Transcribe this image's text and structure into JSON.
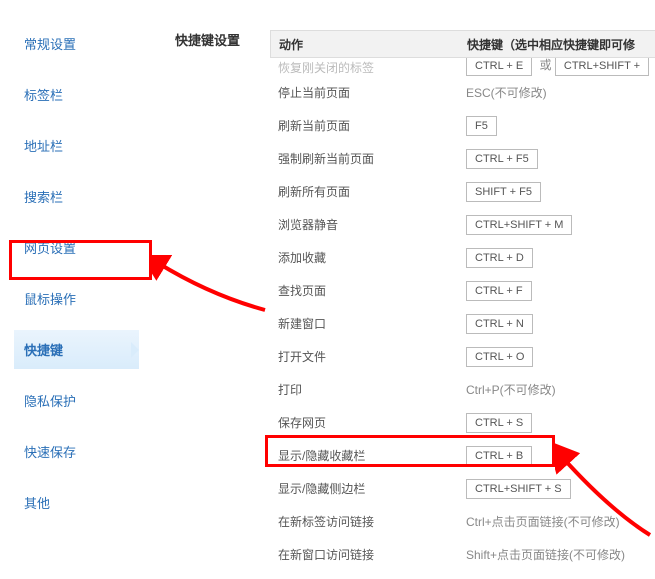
{
  "sidebar": {
    "items": [
      {
        "label": "常规设置"
      },
      {
        "label": "标签栏"
      },
      {
        "label": "地址栏"
      },
      {
        "label": "搜索栏"
      },
      {
        "label": "网页设置"
      },
      {
        "label": "鼠标操作"
      },
      {
        "label": "快捷键"
      },
      {
        "label": "隐私保护"
      },
      {
        "label": "快速保存"
      },
      {
        "label": "其他"
      }
    ],
    "active_index": 6
  },
  "main": {
    "section_title": "快捷键设置",
    "columns": {
      "action": "动作",
      "hotkey": "快捷键（选中相应快捷键即可修"
    },
    "rows": [
      {
        "action": "恢复刚关闭的标签",
        "keys": [
          "CTRL + E"
        ],
        "joiner": "或",
        "keys2": [
          "CTRL+SHIFT +"
        ],
        "type": "box"
      },
      {
        "action": "停止当前页面",
        "text": "ESC(不可修改)",
        "type": "text"
      },
      {
        "action": "刷新当前页面",
        "keys": [
          "F5"
        ],
        "type": "box"
      },
      {
        "action": "强制刷新当前页面",
        "keys": [
          "CTRL + F5"
        ],
        "type": "box"
      },
      {
        "action": "刷新所有页面",
        "keys": [
          "SHIFT + F5"
        ],
        "type": "box"
      },
      {
        "action": "浏览器静音",
        "keys": [
          "CTRL+SHIFT + M"
        ],
        "type": "box"
      },
      {
        "action": "添加收藏",
        "keys": [
          "CTRL + D"
        ],
        "type": "box"
      },
      {
        "action": "查找页面",
        "keys": [
          "CTRL + F"
        ],
        "type": "box"
      },
      {
        "action": "新建窗口",
        "keys": [
          "CTRL + N"
        ],
        "type": "box"
      },
      {
        "action": "打开文件",
        "keys": [
          "CTRL + O"
        ],
        "type": "box"
      },
      {
        "action": "打印",
        "text": "Ctrl+P(不可修改)",
        "type": "text"
      },
      {
        "action": "保存网页",
        "keys": [
          "CTRL + S"
        ],
        "type": "box"
      },
      {
        "action": "显示/隐藏收藏栏",
        "keys": [
          "CTRL + B"
        ],
        "type": "box"
      },
      {
        "action": "显示/隐藏侧边栏",
        "keys": [
          "CTRL+SHIFT + S"
        ],
        "type": "box"
      },
      {
        "action": "在新标签访问链接",
        "text": "Ctrl+点击页面链接(不可修改)",
        "type": "text"
      },
      {
        "action": "在新窗口访问链接",
        "text": "Shift+点击页面链接(不可修改)",
        "type": "text"
      }
    ],
    "highlight_row_index": 12
  }
}
